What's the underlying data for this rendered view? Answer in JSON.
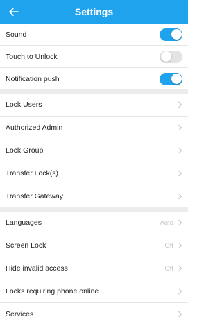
{
  "header": {
    "title": "Settings",
    "back_icon": "arrow-left-icon",
    "color": "#1fa3ec"
  },
  "toggles": [
    {
      "label": "Sound",
      "on": true
    },
    {
      "label": "Touch to Unlock",
      "on": false
    },
    {
      "label": "Notification push",
      "on": true
    }
  ],
  "lock_menu": [
    {
      "label": "Lock Users"
    },
    {
      "label": "Authorized Admin"
    },
    {
      "label": "Lock Group"
    },
    {
      "label": "Transfer Lock(s)"
    },
    {
      "label": "Transfer Gateway"
    }
  ],
  "prefs": [
    {
      "label": "Languages",
      "value": "Auto"
    },
    {
      "label": "Screen Lock",
      "value": "Off"
    },
    {
      "label": "Hide invalid access",
      "value": "Off"
    },
    {
      "label": "Locks requiring phone online",
      "value": ""
    },
    {
      "label": "Services",
      "value": ""
    }
  ]
}
